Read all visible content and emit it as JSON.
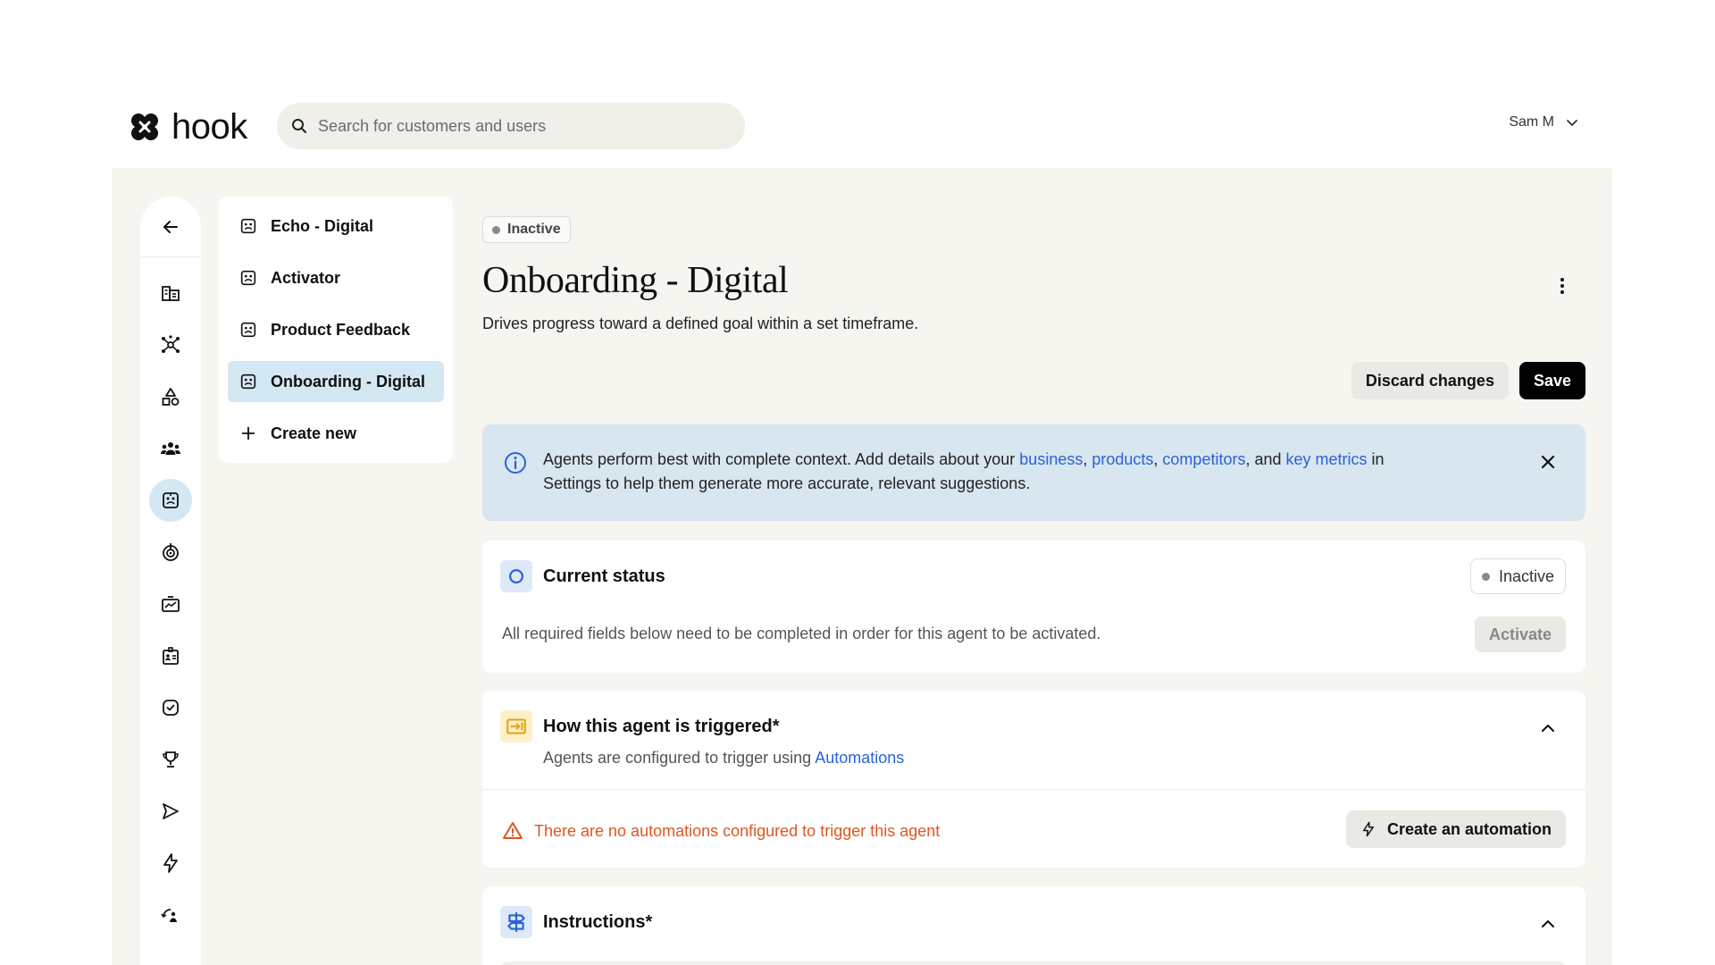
{
  "app": {
    "name": "hook"
  },
  "search": {
    "placeholder": "Search for customers and users"
  },
  "user": {
    "name": "Sam M"
  },
  "rail": {
    "icons": [
      "back-arrow-icon",
      "accounts-icon",
      "network-icon",
      "shapes-icon",
      "people-icon",
      "agent-icon",
      "target-icon",
      "analytics-icon",
      "contact-card-icon",
      "check-circle-icon",
      "trophy-icon",
      "send-icon",
      "lightning-icon",
      "refresh-person-icon"
    ],
    "active": "agent-icon"
  },
  "agents": {
    "items": [
      {
        "label": "Echo - Digital",
        "active": false
      },
      {
        "label": "Activator",
        "active": false
      },
      {
        "label": "Product Feedback",
        "active": false
      },
      {
        "label": "Onboarding - Digital",
        "active": true
      }
    ],
    "create_label": "Create new"
  },
  "page": {
    "status": "Inactive",
    "title": "Onboarding - Digital",
    "subtitle": "Drives progress toward a defined goal within a set timeframe.",
    "discard_label": "Discard changes",
    "save_label": "Save"
  },
  "banner": {
    "text_1": "Agents perform best with complete context. Add details about your ",
    "link_business": "business",
    "sep_1": ", ",
    "link_products": "products",
    "sep_2": ", ",
    "link_competitors": "competitors",
    "sep_3": ", and ",
    "link_metrics": "key metrics",
    "text_2": " in",
    "text_3": "Settings to help them generate more accurate, relevant suggestions."
  },
  "current_status": {
    "title": "Current status",
    "status": "Inactive",
    "description": "All required fields below need to be completed in order for this agent to be activated.",
    "activate_label": "Activate"
  },
  "trigger": {
    "title": "How this agent is triggered*",
    "subtitle_text": "Agents are configured to trigger using ",
    "subtitle_link": "Automations",
    "warning": "There are no automations configured to trigger this agent",
    "create_label": "Create an automation"
  },
  "instructions": {
    "title": "Instructions*"
  },
  "colors": {
    "accent_blue": "#2a62d6",
    "warning": "#e0561e",
    "active_bg": "#d4e8f4",
    "banner_bg": "#d8e6f0"
  }
}
